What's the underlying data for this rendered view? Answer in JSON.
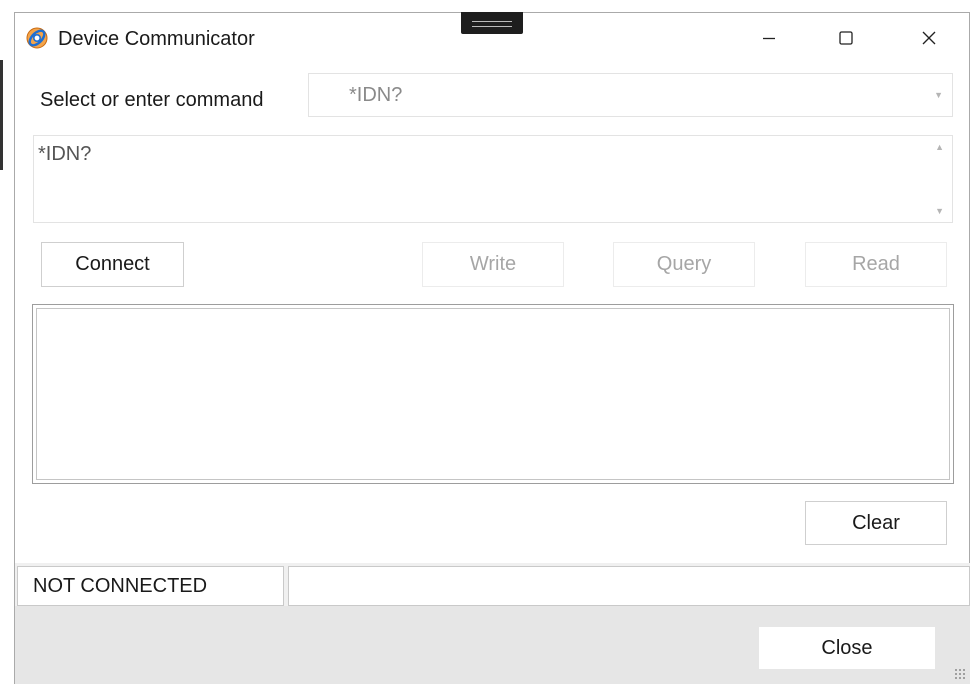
{
  "window": {
    "title": "Device Communicator",
    "caption": {
      "minimize": "─",
      "maximize": "☐",
      "close": "✕"
    }
  },
  "command": {
    "label": "Select or enter command",
    "selected": "*IDN?",
    "text_value": "*IDN?"
  },
  "buttons": {
    "connect": "Connect",
    "write": "Write",
    "query": "Query",
    "read": "Read",
    "clear": "Clear",
    "close": "Close"
  },
  "output": {
    "text": ""
  },
  "status": {
    "connection": "NOT CONNECTED",
    "message": ""
  },
  "icons": {
    "app": "app-logo-icon",
    "dropdown": "chevron-down-icon",
    "scroll_up": "scroll-up-arrow-icon",
    "scroll_down": "scroll-down-arrow-icon"
  },
  "colors": {
    "accent": "#1f6fd1",
    "logo_orange": "#e07b21",
    "footer_bg": "#e6e6e6"
  }
}
